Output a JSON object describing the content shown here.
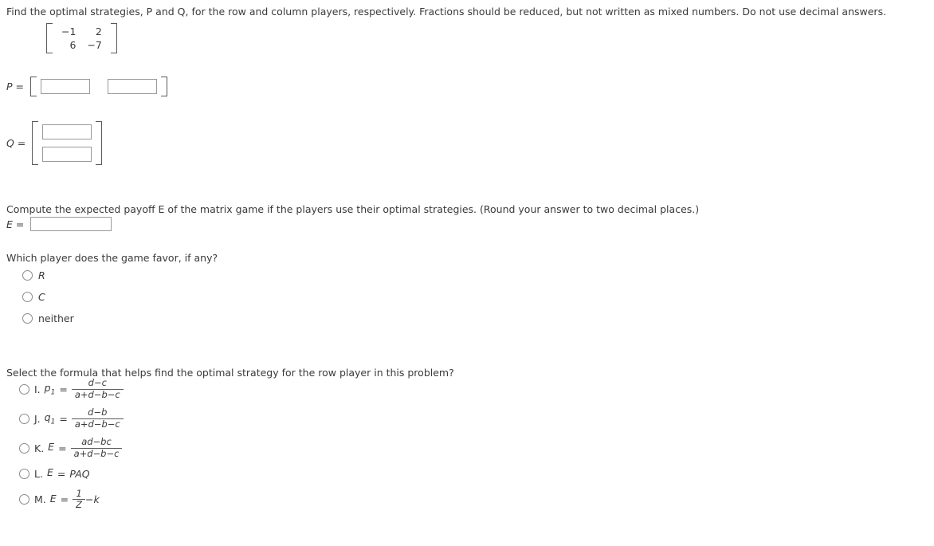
{
  "prompt": "Find the optimal strategies, P and Q, for the row and column players, respectively. Fractions should be reduced, but not written as mixed numbers. Do not use decimal answers.",
  "payoff_matrix": {
    "rows": [
      [
        "−1",
        "2"
      ],
      [
        "6",
        "−7"
      ]
    ]
  },
  "p": {
    "label": "P =",
    "cells": [
      {
        "value": "",
        "placeholder": ""
      },
      {
        "value": "",
        "placeholder": ""
      }
    ]
  },
  "q": {
    "label": "Q =",
    "cells": [
      {
        "value": "",
        "placeholder": ""
      },
      {
        "value": "",
        "placeholder": ""
      }
    ]
  },
  "expected_payoff": {
    "question": "Compute the expected payoff E of the matrix game if the players use their optimal strategies. (Round your answer to two decimal places.)",
    "label": "E =",
    "value": "",
    "placeholder": ""
  },
  "favor": {
    "question": "Which player does the game favor, if any?",
    "options": [
      {
        "label": "R",
        "selected": false
      },
      {
        "label": "C",
        "selected": false
      },
      {
        "label": "neither",
        "selected": false
      }
    ]
  },
  "formula": {
    "question": "Select the formula that helps find the optimal strategy for the row player in this problem?",
    "options": [
      {
        "key": "I.",
        "lhs": "p",
        "sub": "1",
        "eq": "=",
        "kind": "fraction",
        "numerator": "d−c",
        "denominator": "a+d−b−c",
        "trailing": "",
        "selected": false
      },
      {
        "key": "J.",
        "lhs": "q",
        "sub": "1",
        "eq": "=",
        "kind": "fraction",
        "numerator": "d−b",
        "denominator": "a+d−b−c",
        "trailing": "",
        "selected": false
      },
      {
        "key": "K.",
        "lhs": "E",
        "sub": "",
        "eq": "=",
        "kind": "fraction",
        "numerator": "ad−bc",
        "denominator": "a+d−b−c",
        "trailing": "",
        "selected": false
      },
      {
        "key": "L.",
        "lhs": "E",
        "sub": "",
        "eq": "=",
        "kind": "plain",
        "numerator": "",
        "denominator": "",
        "trailing": "PAQ",
        "selected": false
      },
      {
        "key": "M.",
        "lhs": "E",
        "sub": "",
        "eq": "=",
        "kind": "fraction",
        "numerator": "1",
        "denominator": "Z",
        "trailing": "−k",
        "selected": false
      }
    ]
  }
}
